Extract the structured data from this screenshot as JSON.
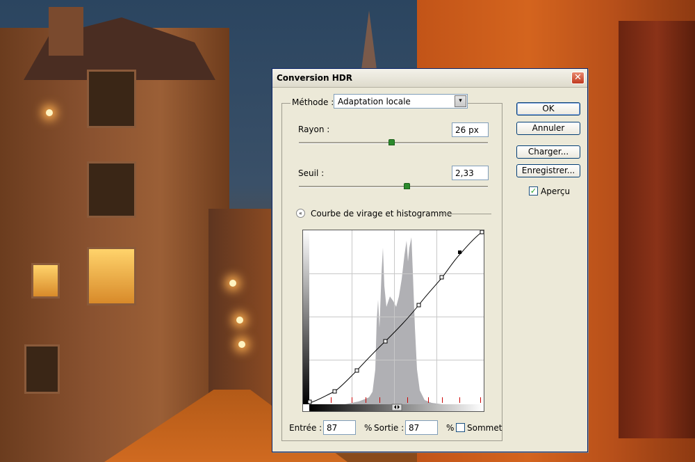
{
  "dialog": {
    "title": "Conversion HDR",
    "close_glyph": "✕"
  },
  "method": {
    "label": "Méthode :",
    "value": "Adaptation locale",
    "arrow_glyph": "▾"
  },
  "radius": {
    "label": "Rayon :",
    "value": "26 px",
    "slider_fraction": 0.49
  },
  "threshold": {
    "label": "Seuil :",
    "value": "2,33",
    "slider_fraction": 0.57
  },
  "curve_section": {
    "toggle_glyph": "«",
    "title": "Courbe de virage et histogramme"
  },
  "io": {
    "input_label": "Entrée :",
    "input_value": "87",
    "output_label": "Sortie :",
    "output_value": "87",
    "percent": "%",
    "corner_label": "Sommet"
  },
  "buttons": {
    "ok": "OK",
    "cancel": "Annuler",
    "load": "Charger...",
    "save": "Enregistrer..."
  },
  "preview": {
    "label": "Aperçu",
    "checked": true,
    "check_glyph": "✓"
  },
  "colors": {
    "accent": "#003c74",
    "histogram": "#b0b0b4",
    "slider_thumb": "#2c8a2c"
  }
}
